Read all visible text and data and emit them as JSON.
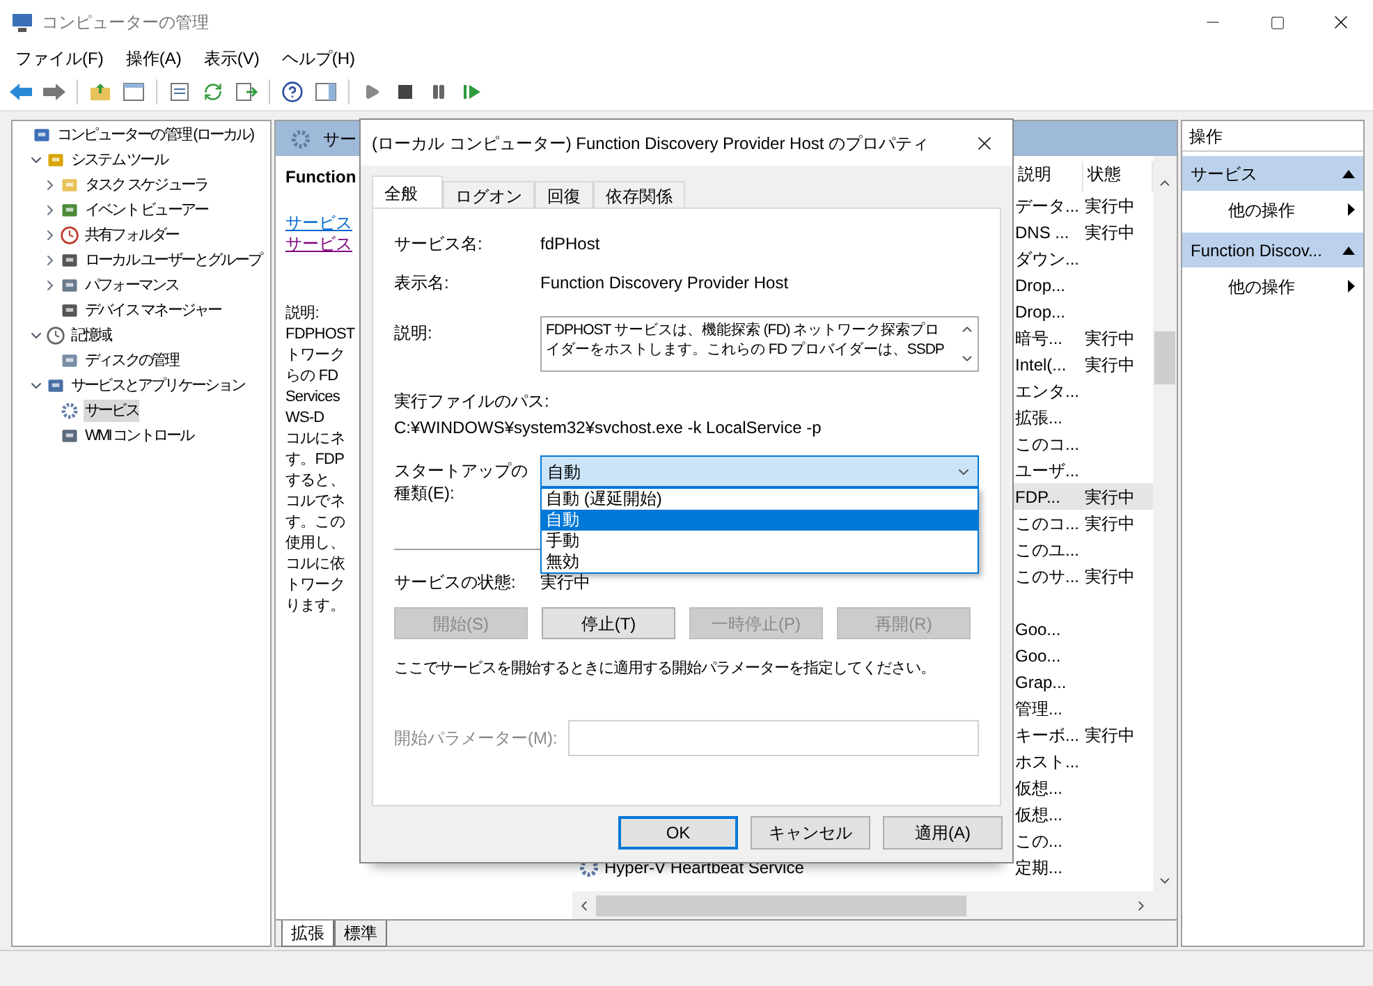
{
  "window": {
    "title": "コンピューターの管理"
  },
  "menu": [
    "ファイル(F)",
    "操作(A)",
    "表示(V)",
    "ヘルプ(H)"
  ],
  "tree": [
    {
      "label": "コンピューターの管理 (ローカル)",
      "selected": false,
      "children": [
        {
          "label": "システム ツール",
          "selected": false,
          "expanded": true,
          "children": [
            {
              "label": "タスク スケジューラ",
              "selected": false,
              "expanded": false
            },
            {
              "label": "イベント ビューアー",
              "selected": false,
              "expanded": false
            },
            {
              "label": "共有フォルダー",
              "selected": false,
              "expanded": false
            },
            {
              "label": "ローカル ユーザーとグループ",
              "selected": false,
              "expanded": false
            },
            {
              "label": "パフォーマンス",
              "selected": false,
              "expanded": false
            },
            {
              "label": "デバイス マネージャー",
              "selected": false
            }
          ]
        },
        {
          "label": "記憶域",
          "selected": false,
          "expanded": true,
          "children": [
            {
              "label": "ディスクの管理",
              "selected": false
            }
          ]
        },
        {
          "label": "サービスとアプリケーション",
          "selected": false,
          "expanded": true,
          "children": [
            {
              "label": "サービス",
              "selected": true
            },
            {
              "label": "WMI コントロール",
              "selected": false
            }
          ]
        }
      ]
    }
  ],
  "services_pane": {
    "header": "サー",
    "service_title": "Function",
    "links": [
      "サービス",
      "サービス"
    ],
    "description_lines": [
      "説明:",
      "FDPHOST",
      "トワーク",
      "らの FD",
      "Services",
      "WS-D",
      "コルにネ",
      "す。FDP",
      "すると、",
      "コルでネ",
      "す。この",
      "使用し、",
      "コルに依",
      "トワーク",
      "ります。"
    ],
    "columns": [
      "説明",
      "状態"
    ],
    "rows": [
      {
        "description": "データ...",
        "status": "実行中",
        "selected": false
      },
      {
        "description": "DNS ...",
        "status": "実行中",
        "selected": false
      },
      {
        "description": "ダウン...",
        "selected": false
      },
      {
        "description": "Drop...",
        "selected": false
      },
      {
        "description": "Drop...",
        "selected": false
      },
      {
        "description": "暗号...",
        "status": "実行中",
        "selected": false
      },
      {
        "description": "Intel(...",
        "status": "実行中",
        "selected": false
      },
      {
        "description": "エンタ...",
        "selected": false
      },
      {
        "description": "拡張...",
        "selected": false
      },
      {
        "description": "このコ...",
        "selected": false
      },
      {
        "description": "ユーザ...",
        "selected": false
      },
      {
        "description": "FDP...",
        "status": "実行中",
        "selected": true
      },
      {
        "description": "このコ...",
        "status": "実行中",
        "selected": false
      },
      {
        "description": "このユ...",
        "selected": false
      },
      {
        "description": "このサ...",
        "status": "実行中",
        "selected": false
      },
      {
        "selected": false
      },
      {
        "description": "Goo...",
        "selected": false
      },
      {
        "description": "Goo...",
        "selected": false
      },
      {
        "description": "Grap...",
        "selected": false
      },
      {
        "description": "管理...",
        "selected": false
      },
      {
        "description": "キーボ...",
        "status": "実行中",
        "selected": false
      },
      {
        "description": "ホスト...",
        "selected": false
      },
      {
        "description": "仮想...",
        "selected": false
      },
      {
        "description": "仮想...",
        "selected": false
      },
      {
        "description": "この...",
        "selected": false
      },
      {
        "name": "Hyper-V Heartbeat Service",
        "description": "定期...",
        "selected": false
      }
    ],
    "bottom_tabs": [
      {
        "label": "拡張",
        "selected": true
      },
      {
        "label": "標準",
        "selected": false
      }
    ]
  },
  "actions_pane": {
    "title": "操作",
    "groups": [
      {
        "title": "サービス",
        "items": [
          "他の操作"
        ]
      },
      {
        "title": "Function Discov...",
        "items": [
          "他の操作"
        ]
      }
    ]
  },
  "dialog": {
    "title": "(ローカル コンピューター) Function Discovery Provider Host のプロパティ",
    "tabs": [
      {
        "label": "全般",
        "selected": true
      },
      {
        "label": "ログオン",
        "selected": false
      },
      {
        "label": "回復",
        "selected": false
      },
      {
        "label": "依存関係",
        "selected": false
      }
    ],
    "fields": [
      {
        "label": "サービス名:",
        "value": "fdPHost"
      },
      {
        "label": "表示名:",
        "value": "Function Discovery Provider Host"
      }
    ],
    "description_label": "説明:",
    "description_lines": [
      "FDPHOST サービスは、機能探索 (FD) ネットワーク探索プロ",
      "イダーをホストします。これらの FD プロバイダーは、SSDP"
    ],
    "path_label": "実行ファイルのパス:",
    "path": "C:¥WINDOWS¥system32¥svchost.exe -k LocalService -p",
    "startup_label": "スタートアップの種類(E):",
    "startup_value": "自動",
    "startup_options": [
      {
        "label": "自動 (遅延開始)",
        "selected": false
      },
      {
        "label": "自動",
        "selected": true
      },
      {
        "label": "手動",
        "selected": false
      },
      {
        "label": "無効",
        "selected": false
      }
    ],
    "status_label": "サービスの状態:",
    "status": "実行中",
    "service_buttons": [
      {
        "label": "開始(S)",
        "disabled": true
      },
      {
        "label": "停止(T)",
        "disabled": false
      },
      {
        "label": "一時停止(P)",
        "disabled": true
      },
      {
        "label": "再開(R)",
        "disabled": true
      }
    ],
    "hint": "ここでサービスを開始するときに適用する開始パラメーターを指定してください。",
    "param_label": "開始パラメーター(M):",
    "param_disabled": true,
    "buttons": [
      {
        "label": "OK",
        "default": true
      },
      {
        "label": "キャンセル",
        "default": false
      },
      {
        "label": "適用(A)",
        "default": false
      }
    ]
  }
}
